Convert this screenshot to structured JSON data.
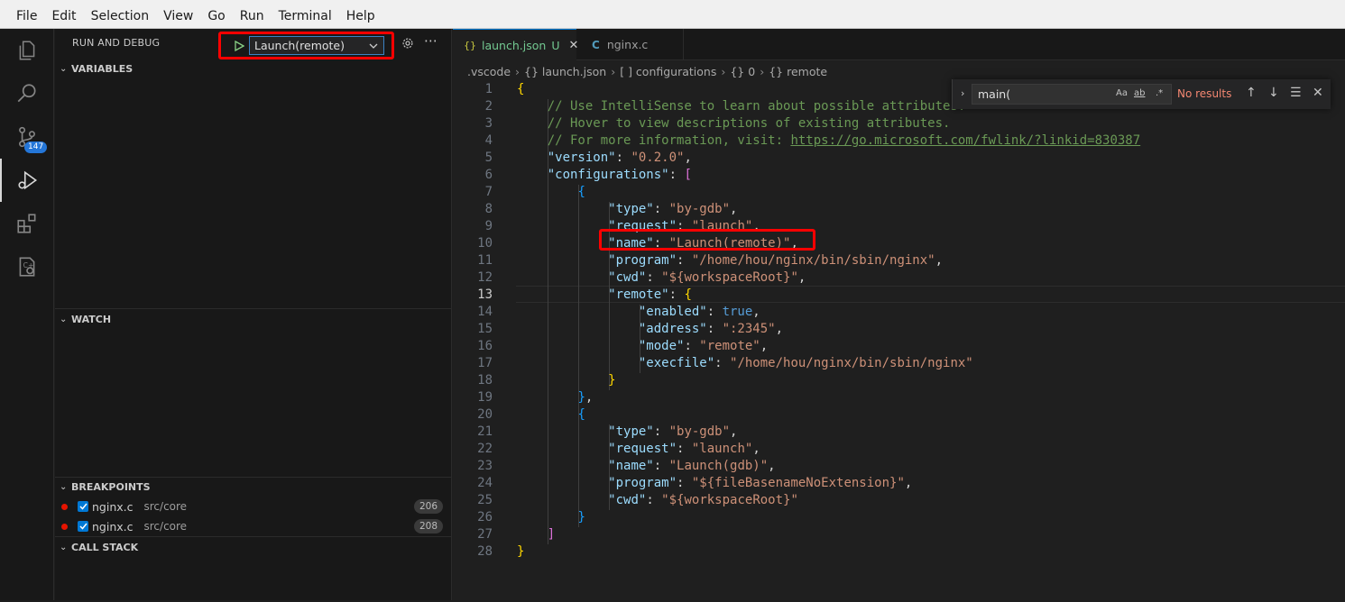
{
  "menu": [
    "File",
    "Edit",
    "Selection",
    "View",
    "Go",
    "Run",
    "Terminal",
    "Help"
  ],
  "activity": {
    "scm_badge": "147"
  },
  "sidebar": {
    "title": "RUN AND DEBUG",
    "launch_config": "Launch(remote)",
    "sections": {
      "variables": "VARIABLES",
      "watch": "WATCH",
      "breakpoints": "BREAKPOINTS",
      "callstack": "CALL STACK"
    },
    "breakpoints": [
      {
        "file": "nginx.c",
        "path": "src/core",
        "line": "206"
      },
      {
        "file": "nginx.c",
        "path": "src/core",
        "line": "208"
      }
    ]
  },
  "tabs": [
    {
      "icon": "{}",
      "label": "launch.json",
      "status": "U"
    },
    {
      "icon": "C",
      "label": "nginx.c"
    }
  ],
  "breadcrumb": [
    ".vscode",
    "{} launch.json",
    "[ ] configurations",
    "{} 0",
    "{} remote"
  ],
  "find": {
    "query": "main(",
    "case_label": "Aa",
    "word_label": "ab",
    "regex_label": ".*",
    "result": "No results"
  },
  "code_lines": [
    "{",
    "    // Use IntelliSense to learn about possible attributes.",
    "    // Hover to view descriptions of existing attributes.",
    "    // For more information, visit: https://go.microsoft.com/fwlink/?linkid=830387",
    "    \"version\": \"0.2.0\",",
    "    \"configurations\": [",
    "        {",
    "            \"type\": \"by-gdb\",",
    "            \"request\": \"launch\",",
    "            \"name\": \"Launch(remote)\",",
    "            \"program\": \"/home/hou/nginx/bin/sbin/nginx\",",
    "            \"cwd\": \"${workspaceRoot}\",",
    "            \"remote\": {",
    "                \"enabled\": true,",
    "                \"address\": \":2345\",",
    "                \"mode\": \"remote\",",
    "                \"execfile\": \"/home/hou/nginx/bin/sbin/nginx\"",
    "            }",
    "        },",
    "        {",
    "            \"type\": \"by-gdb\",",
    "            \"request\": \"launch\",",
    "            \"name\": \"Launch(gdb)\",",
    "            \"program\": \"${fileBasenameNoExtension}\",",
    "            \"cwd\": \"${workspaceRoot}\"",
    "        }",
    "    ]",
    "}"
  ],
  "current_line": 13
}
